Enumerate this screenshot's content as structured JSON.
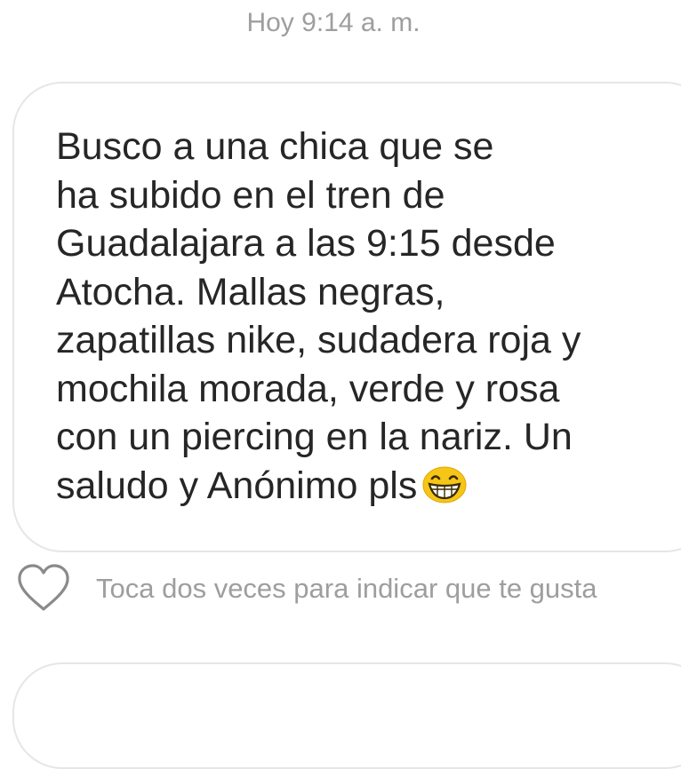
{
  "timestamp": "Hoy 9:14 a. m.",
  "message": {
    "text": "Busco a una chica que se\nha subido en el tren de\nGuadalajara a las 9:15 desde\nAtocha. Mallas negras,\nzapatillas nike, sudadera roja y\nmochila morada, verde y rosa\ncon un piercing en la nariz. Un\nsaludo y Anónimo pls",
    "emoji": "grinning-face-emoji"
  },
  "like_hint": "Toca dos veces para indicar que te gusta",
  "icons": {
    "like": "heart-outline-icon"
  },
  "colors": {
    "text": "#262626",
    "secondary_text": "#9e9e9e",
    "bubble_border": "#e6e6e6",
    "emoji_fill": "#f5c518"
  }
}
